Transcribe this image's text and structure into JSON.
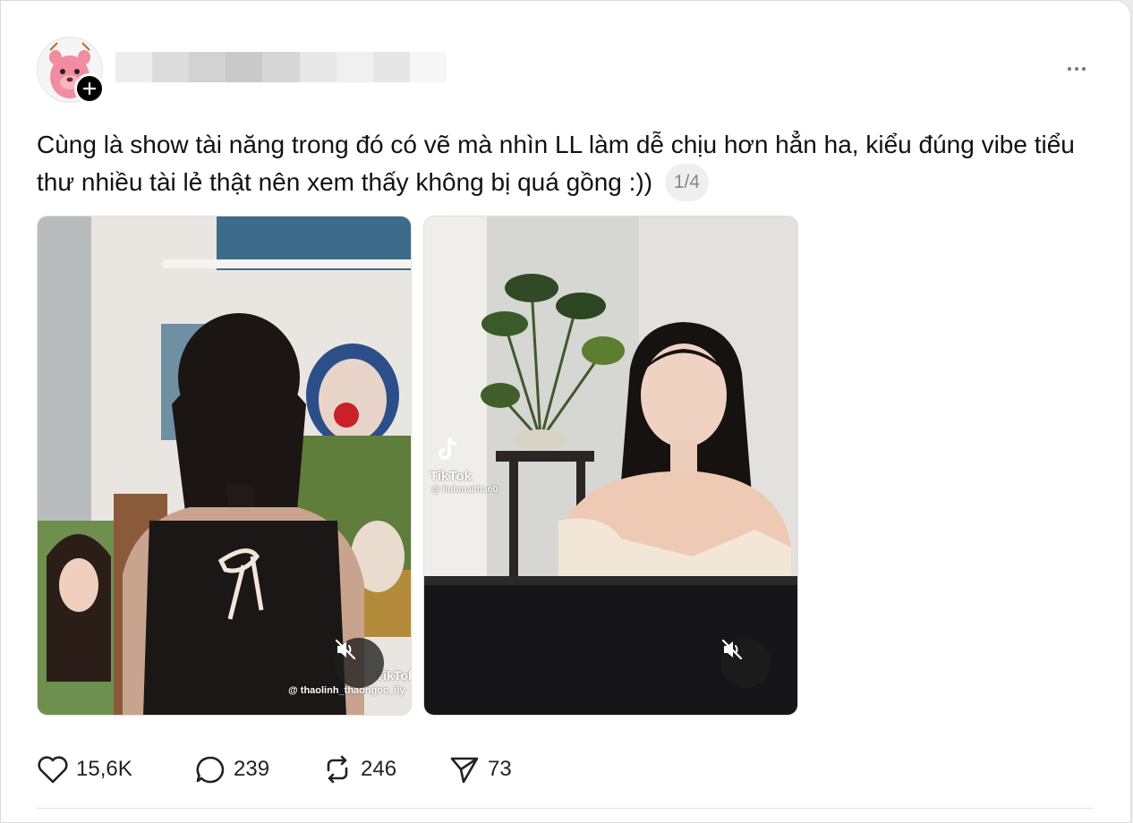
{
  "post": {
    "text": "Cùng là show tài năng trong đó có vẽ mà nhìn LL làm dễ chịu hơn hẳn ha, kiểu đúng vibe tiểu thư nhiều tài lẻ thật nên xem thấy không bị quá gồng :))",
    "media_counter": "1/4"
  },
  "media": [
    {
      "watermark_brand": "TikTok",
      "watermark_handle": "@ thaolinh_thaongoc_ily"
    },
    {
      "watermark_brand": "TikTok",
      "watermark_handle": "@ linhmaithao0"
    }
  ],
  "actions": {
    "likes": "15,6K",
    "replies": "239",
    "reposts": "246",
    "shares": "73"
  },
  "icons": {
    "like": "heart-icon",
    "reply": "comment-bubble-icon",
    "repost": "repost-icon",
    "share": "send-icon",
    "mute": "speaker-muted-icon",
    "follow": "plus-icon",
    "more": "more-horizontal-icon"
  }
}
